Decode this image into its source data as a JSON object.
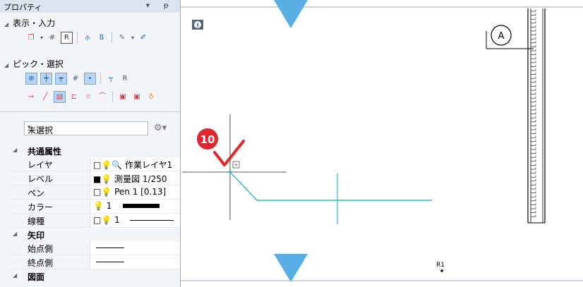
{
  "panel": {
    "title": "プロパティ",
    "title_controls": "▾ ᵽ",
    "sections": {
      "display_input": "表示・入力",
      "pick_select": "ピック・選択"
    },
    "selection_combo": "未選択",
    "groups": {
      "common": "共通属性",
      "arrow": "矢印",
      "drawing": "図面"
    },
    "common_rows": [
      {
        "key": "レイヤ",
        "value": "□💡🔍 作業レイヤ1"
      },
      {
        "key": "レベル",
        "value": "■💡 測量図 1/250"
      },
      {
        "key": "ペン",
        "value": "□💡 Pen 1 [0.13]"
      },
      {
        "key": "カラー",
        "value": "💡 1"
      },
      {
        "key": "線種",
        "value": "□💡 1"
      }
    ],
    "arrow_rows": [
      {
        "key": "始点側"
      },
      {
        "key": "終点側"
      }
    ]
  },
  "canvas": {
    "info_button": "!",
    "step_badge": "10",
    "grid_label": "A",
    "point_label": "R1"
  },
  "colors": {
    "accent_red": "#e3262d",
    "cyan_line": "#2ab8c8",
    "marker_blue": "#5aaee6",
    "panel_bg": "#f2f4f7"
  }
}
